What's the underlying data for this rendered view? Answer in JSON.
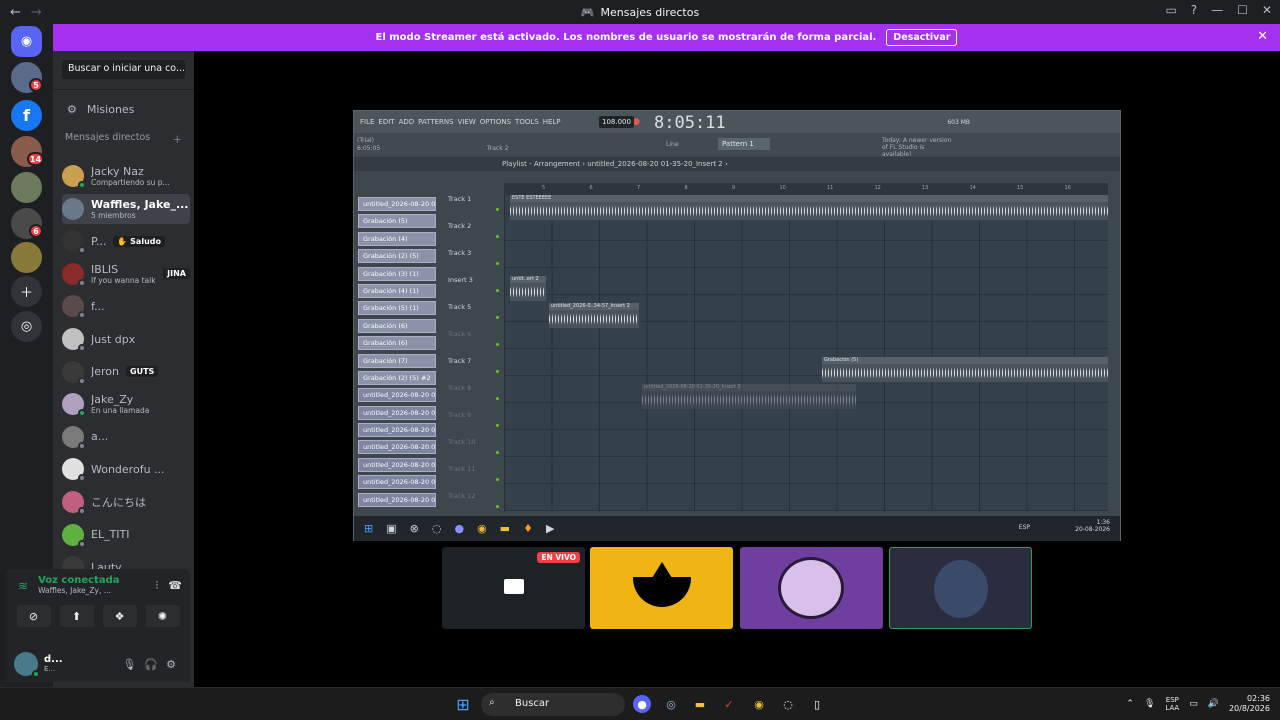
{
  "window": {
    "title": "Mensajes directos"
  },
  "banner": {
    "text": "El modo Streamer está activado. Los nombres de usuario se mostrarán de forma parcial.",
    "button": "Desactivar",
    "color": "#a531f0"
  },
  "servers": {
    "badges": [
      "5",
      "14",
      "6"
    ]
  },
  "sidebar": {
    "search_placeholder": "Buscar o iniciar una co...",
    "misiones": "Misiones",
    "dm_header": "Mensajes directos",
    "dms": [
      {
        "name": "Jacky Naz",
        "sub": "Compartiendo su p...",
        "tag": "",
        "status": "online"
      },
      {
        "name": "Waffles, Jake_...",
        "sub": "5 miembros",
        "tag": "",
        "status": "group",
        "selected": true
      },
      {
        "name": "P...",
        "sub": "",
        "tag": "✋ Saludo",
        "status": "offline"
      },
      {
        "name": "IBLIS",
        "sub": "If you wanna talk to ...",
        "tag": "JINA",
        "status": "offline"
      },
      {
        "name": "f...",
        "sub": "",
        "tag": "",
        "status": "offline"
      },
      {
        "name": "Just dpx",
        "sub": "",
        "tag": "",
        "status": "offline"
      },
      {
        "name": "Jeron",
        "sub": "",
        "tag": "GUTS",
        "status": "offline"
      },
      {
        "name": "Jake_Zy",
        "sub": "En una llamada",
        "tag": "",
        "status": "online"
      },
      {
        "name": "a...",
        "sub": "",
        "tag": "",
        "status": "offline"
      },
      {
        "name": "Wonderofu ...",
        "sub": "",
        "tag": "",
        "status": "offline"
      },
      {
        "name": "こんにちは",
        "sub": "",
        "tag": "",
        "status": "offline"
      },
      {
        "name": "EL_TITI",
        "sub": "",
        "tag": "",
        "status": "offline"
      },
      {
        "name": "Lauty",
        "sub": "",
        "tag": "",
        "status": "offline"
      }
    ]
  },
  "voice": {
    "title": "Voz conectada",
    "channel": "Waffles, Jake_Zy, ..."
  },
  "user": {
    "name": "d...",
    "status": "E..."
  },
  "fl": {
    "menu": [
      "FILE",
      "EDIT",
      "ADD",
      "PATTERNS",
      "VIEW",
      "OPTIONS",
      "TOOLS",
      "HELP"
    ],
    "bpm": "108.000",
    "time": "8:05:11",
    "trial": "(Trial)",
    "trial_time": "6:05:05",
    "track_hint": "Track 2",
    "pattern": "Pattern 1",
    "line": "Line",
    "mem": "603 MB",
    "news": "Today: A newer version of FL Studio is available!",
    "playlist_title": "Playlist - Arrangement › untitled_2026-08-20 01-35-20_Insert 2 ›",
    "ruler": [
      "5",
      "6",
      "7",
      "8",
      "9",
      "10",
      "11",
      "12",
      "13",
      "14",
      "15",
      "16"
    ],
    "channels": [
      "untitled_2026-08-20 00-...",
      "Grabación (5)",
      "Grabación (4)",
      "Grabación (2) (5)",
      "Grabación (3) (1)",
      "Grabación (4) (1)",
      "Grabación (5) (1)",
      "Grabación (6)",
      "Grabación (6)",
      "Grabación (7)",
      "Grabación (2) (5) #2",
      "untitled_2026-08-20 01-...",
      "untitled_2026-08-20 01-...",
      "untitled_2026-08-20 01-...",
      "untitled_2026-08-20 01-...",
      "untitled_2026-08-20 01-...",
      "untitled_2026-08-20 01-...",
      "untitled_2026-08-20 01-..."
    ],
    "tracks": [
      "Track 1",
      "Track 2",
      "Track 3",
      "Insert 3",
      "Track 5",
      "Track 6",
      "Track 7",
      "Track 8",
      "Track 9",
      "Track 10",
      "Track 11",
      "Track 12"
    ],
    "clips": [
      {
        "label": "ESTE ESTEEEEE"
      },
      {
        "label": "untit..ert 2"
      },
      {
        "label": "untitled_2026-0..34-57_Insert 2"
      },
      {
        "label": "Grabación (5)"
      },
      {
        "label": "untitled_2026-08-20 01-35-20_Insert 2"
      }
    ],
    "tray_lang": "ESP",
    "clock_time": "1:36",
    "clock_date": "20-08-2026"
  },
  "streams": {
    "live_label": "EN VIVO"
  },
  "taskbar": {
    "search": "Buscar",
    "lang": "ESP",
    "layout": "LAA",
    "time": "02:36",
    "date": "20/8/2026"
  }
}
